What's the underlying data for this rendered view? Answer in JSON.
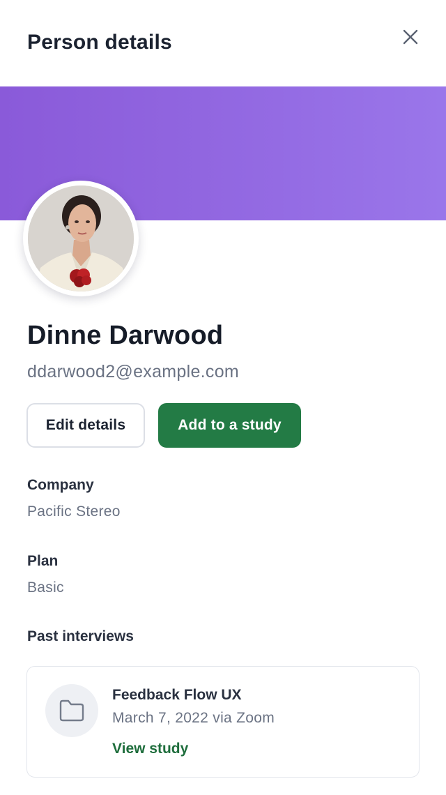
{
  "header": {
    "title": "Person details",
    "close_icon": "close-icon"
  },
  "colors": {
    "banner_start": "#8a5ad9",
    "banner_end": "#9a76ea",
    "primary_button": "#237b45",
    "link": "#1f6e3d"
  },
  "person": {
    "name": "Dinne Darwood",
    "email": "ddarwood2@example.com"
  },
  "actions": {
    "edit_label": "Edit details",
    "add_label": "Add to a study"
  },
  "fields": [
    {
      "label": "Company",
      "value": "Pacific Stereo"
    },
    {
      "label": "Plan",
      "value": "Basic"
    }
  ],
  "past_interviews": {
    "heading": "Past interviews",
    "items": [
      {
        "icon": "folder-icon",
        "title": "Feedback Flow UX",
        "subtitle": "March 7, 2022 via Zoom",
        "link_label": "View study"
      }
    ]
  }
}
